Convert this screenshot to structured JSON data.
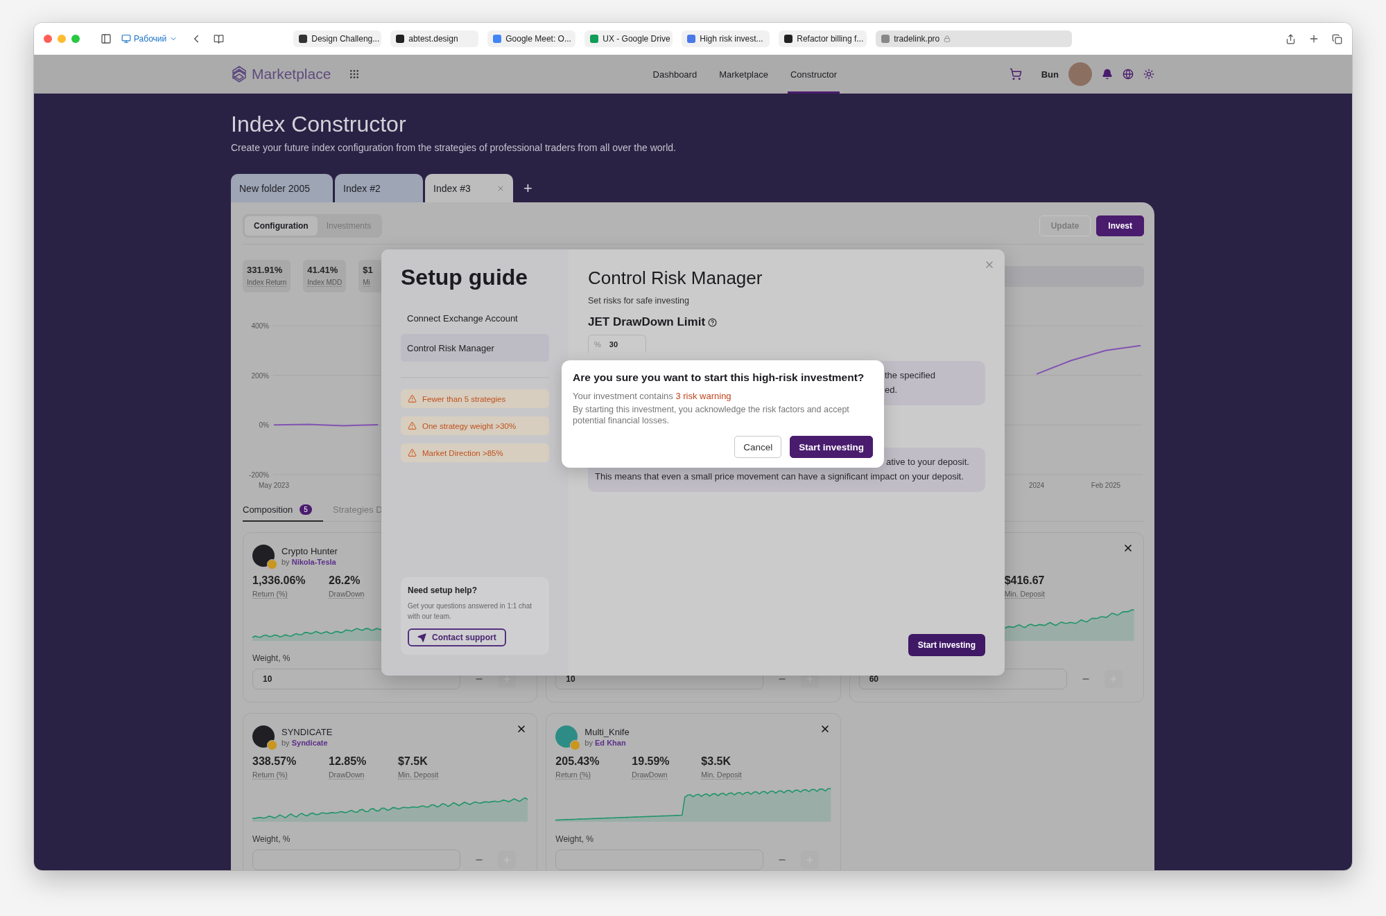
{
  "browser": {
    "workspace": "Рабочий",
    "tabs": [
      {
        "title": "Design Challeng...",
        "selected": false
      },
      {
        "title": "abtest.design",
        "selected": false
      },
      {
        "title": "Google Meet: O...",
        "selected": false
      },
      {
        "title": "UX - Google Drive",
        "selected": false
      },
      {
        "title": "High risk invest...",
        "selected": false
      },
      {
        "title": "Refactor billing f...",
        "selected": false
      },
      {
        "title": "tradelink.pro",
        "selected": true
      }
    ]
  },
  "header": {
    "logo": "Marketplace",
    "nav": [
      {
        "label": "Dashboard",
        "selected": false
      },
      {
        "label": "Marketplace",
        "selected": false
      },
      {
        "label": "Constructor",
        "selected": true
      }
    ],
    "user": "Bun"
  },
  "page": {
    "title": "Index Constructor",
    "subtitle": "Create your future index configuration from the strategies of professional traders from all over the world."
  },
  "index_tabs": [
    {
      "label": "New folder 2005",
      "selected": false,
      "closable": false
    },
    {
      "label": "Index #2",
      "selected": false,
      "closable": false
    },
    {
      "label": "Index #3",
      "selected": true,
      "closable": true
    }
  ],
  "add_tab": "+",
  "view_toggle": [
    {
      "label": "Configuration",
      "selected": true
    },
    {
      "label": "Investments",
      "selected": false
    }
  ],
  "actions": [
    {
      "label": "Update",
      "disabled": true
    },
    {
      "label": "Invest",
      "disabled": false
    }
  ],
  "stats": [
    {
      "value": "331.91%",
      "label": "Index Return"
    },
    {
      "value": "41.41%",
      "label": "Index MDD"
    },
    {
      "value": "$1",
      "label": "Mi"
    }
  ],
  "chart": {
    "chart_data": {
      "type": "line",
      "categories": [
        "May 2023",
        null,
        null,
        null,
        null,
        null,
        null,
        null,
        null,
        null,
        null,
        null,
        null,
        null,
        null,
        null,
        null,
        null,
        null,
        null,
        null,
        null,
        "2024",
        null,
        "Feb 2025",
        null
      ],
      "ylim": [
        -200,
        400
      ],
      "yticks": [
        {
          "value": 400,
          "label": "400%"
        },
        {
          "value": 200,
          "label": "200%"
        },
        {
          "value": 0,
          "label": "0%"
        },
        {
          "value": -200,
          "label": "-200%"
        }
      ],
      "series": [
        {
          "color": "#8253b3",
          "values": [
            0,
            2,
            -3,
            1,
            null,
            null,
            null,
            null,
            null,
            null,
            null,
            null,
            null,
            null,
            null,
            null,
            null,
            null,
            null,
            null,
            null,
            null,
            205,
            260,
            300,
            320
          ]
        }
      ]
    }
  },
  "composition_tabs": [
    {
      "label": "Composition",
      "count": "5",
      "selected": true
    },
    {
      "label": "Strategies D",
      "selected": false
    }
  ],
  "strategies": [
    {
      "name": "Crypto Hunter",
      "by": "by",
      "author": "Nikola-Tesla",
      "stats": [
        {
          "kind": "return",
          "value": "1,336.06%",
          "label": "Return (%)"
        },
        {
          "kind": "drawdown",
          "value": "26.2%",
          "label": "DrawDown"
        }
      ],
      "close_button": false,
      "sparkline": true,
      "weight_label": "Weight, %",
      "weight": "10"
    },
    {
      "close_button": false,
      "sparkline": false,
      "weight": "10"
    },
    {
      "stats": [
        {
          "kind": "min_deposit",
          "value": "$416.67",
          "label": "Min. Deposit"
        }
      ],
      "close_button": true,
      "sparkline": true,
      "weight": "60"
    },
    {
      "name": "SYNDICATE",
      "by": "by",
      "author": "Syndicate",
      "stats": [
        {
          "kind": "return",
          "value": "338.57%",
          "label": "Return (%)"
        },
        {
          "kind": "drawdown",
          "value": "12.85%",
          "label": "DrawDown"
        },
        {
          "kind": "min_deposit",
          "value": "$7.5K",
          "label": "Min. Deposit"
        }
      ],
      "close_button": true,
      "sparkline": true,
      "weight_label": "Weight, %"
    },
    {
      "name": "Multi_Knife",
      "by": "by",
      "author": "Ed Khan",
      "stats": [
        {
          "kind": "return",
          "value": "205.43%",
          "label": "Return (%)"
        },
        {
          "kind": "drawdown",
          "value": "19.59%",
          "label": "DrawDown"
        },
        {
          "kind": "min_deposit",
          "value": "$3.5K",
          "label": "Min. Deposit"
        }
      ],
      "close_button": true,
      "sparkline": true,
      "weight_label": "Weight, %"
    }
  ],
  "setup_guide": {
    "title": "Setup guide",
    "steps": [
      {
        "label": "Connect Exchange Account",
        "selected": false
      },
      {
        "label": "Control Risk Manager",
        "selected": true
      }
    ],
    "warnings": [
      "Fewer than 5 strategies",
      "One strategy weight >30%",
      "Market Direction >85%"
    ],
    "help": {
      "title": "Need setup help?",
      "text": "Get your questions answered in 1:1 chat with our team.",
      "button": "Contact support"
    },
    "section_title": "Control Risk Manager",
    "section_subtitle": "Set risks for safe investing",
    "limit_label": "JET DrawDown Limit",
    "limit_unit": "%",
    "limit_value": "30",
    "notes": [
      {
        "covered_lines": [
          "the specified",
          "ed."
        ]
      },
      {
        "covered_lines": [
          "ative to your deposit."
        ],
        "text": "This means that even a small price movement can have a significant impact on your deposit."
      }
    ],
    "primary_button": "Start investing"
  },
  "confirm_dialog": {
    "title": "Are you sure you want to start this high-risk investment?",
    "summary": "Your investment contains",
    "warning_count": "3 risk warning",
    "body": "By starting this investment, you acknowledge the risk factors and accept potential financial losses.",
    "buttons": [
      {
        "label": "Cancel",
        "kind": "secondary"
      },
      {
        "label": "Start investing",
        "kind": "primary"
      }
    ]
  }
}
